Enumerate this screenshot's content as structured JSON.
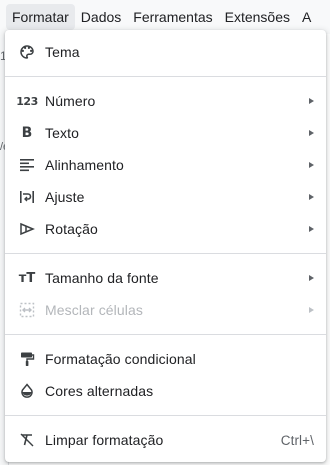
{
  "menubar": {
    "items": [
      "Formatar",
      "Dados",
      "Ferramentas",
      "Extensões",
      "A"
    ]
  },
  "background": {
    "left_fragment_1": "1",
    "left_fragment_2": "/e"
  },
  "menu": {
    "items": [
      {
        "label": "Tema",
        "icon": "palette-icon"
      },
      {
        "label": "Número",
        "icon": "number-format-icon",
        "submenu": true
      },
      {
        "label": "Texto",
        "icon": "bold-icon",
        "submenu": true
      },
      {
        "label": "Alinhamento",
        "icon": "align-left-icon",
        "submenu": true
      },
      {
        "label": "Ajuste",
        "icon": "text-wrap-icon",
        "submenu": true
      },
      {
        "label": "Rotação",
        "icon": "text-rotation-icon",
        "submenu": true
      },
      {
        "label": "Tamanho da fonte",
        "icon": "font-size-icon",
        "submenu": true
      },
      {
        "label": "Mesclar células",
        "icon": "merge-cells-icon",
        "submenu": true,
        "disabled": true
      },
      {
        "label": "Formatação condicional",
        "icon": "paint-roller-icon"
      },
      {
        "label": "Cores alternadas",
        "icon": "alternating-colors-icon"
      },
      {
        "label": "Limpar formatação",
        "icon": "clear-format-icon",
        "shortcut": "Ctrl+\\"
      }
    ],
    "number_icon_text": "123",
    "bold_icon_text": "B",
    "font_size_icon_text": "тT"
  }
}
